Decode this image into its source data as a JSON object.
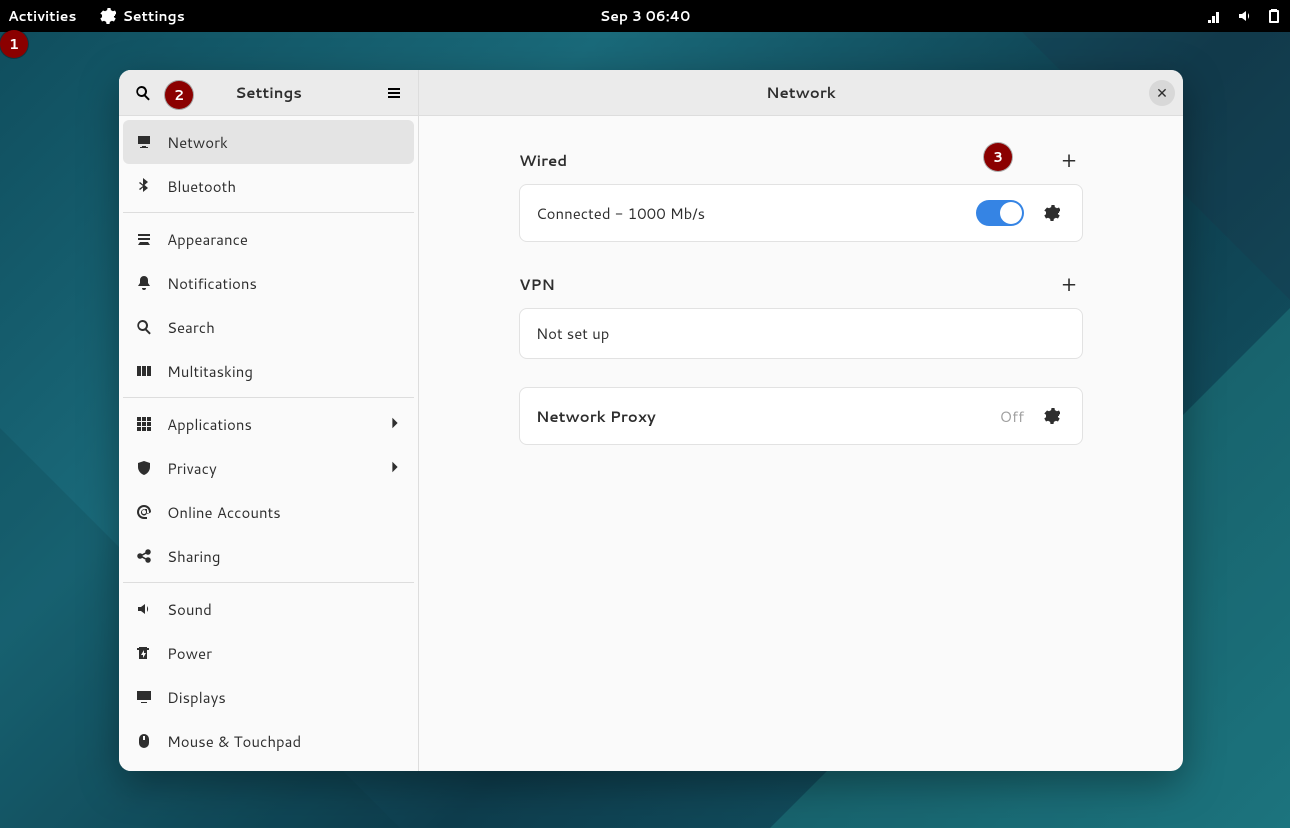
{
  "topbar": {
    "activities": "Activities",
    "app_name": "Settings",
    "clock": "Sep 3  06:40"
  },
  "markers": [
    "1",
    "2",
    "3"
  ],
  "sidebar": {
    "title": "Settings",
    "items": [
      {
        "label": "Network",
        "icon": "monitor",
        "selected": true
      },
      {
        "label": "Bluetooth",
        "icon": "bluetooth",
        "selected": false
      },
      {
        "sep": true
      },
      {
        "label": "Appearance",
        "icon": "appearance",
        "selected": false
      },
      {
        "label": "Notifications",
        "icon": "bell",
        "selected": false
      },
      {
        "label": "Search",
        "icon": "search",
        "selected": false
      },
      {
        "label": "Multitasking",
        "icon": "multitask",
        "selected": false
      },
      {
        "sep": true
      },
      {
        "label": "Applications",
        "icon": "apps",
        "selected": false,
        "chev": true
      },
      {
        "label": "Privacy",
        "icon": "privacy",
        "selected": false,
        "chev": true
      },
      {
        "label": "Online Accounts",
        "icon": "at",
        "selected": false
      },
      {
        "label": "Sharing",
        "icon": "share",
        "selected": false
      },
      {
        "sep": true
      },
      {
        "label": "Sound",
        "icon": "sound",
        "selected": false
      },
      {
        "label": "Power",
        "icon": "power",
        "selected": false
      },
      {
        "label": "Displays",
        "icon": "display",
        "selected": false
      },
      {
        "label": "Mouse & Touchpad",
        "icon": "mouse",
        "selected": false
      }
    ]
  },
  "content": {
    "title": "Network",
    "wired_label": "Wired",
    "wired_status": "Connected - 1000 Mb/s",
    "vpn_label": "VPN",
    "vpn_status": "Not set up",
    "proxy_label": "Network Proxy",
    "proxy_status": "Off"
  }
}
